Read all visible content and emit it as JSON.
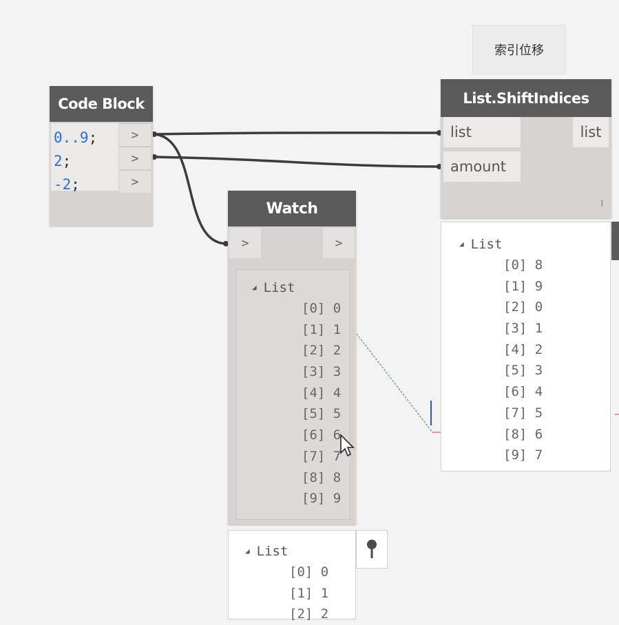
{
  "group_note": "索引位移",
  "code_block": {
    "title": "Code Block",
    "lines": [
      {
        "value": "0..9",
        "semi": ";"
      },
      {
        "value": "2",
        "semi": ";"
      },
      {
        "value": "-2",
        "semi": ";"
      }
    ],
    "port_label": ">"
  },
  "shift_node": {
    "title": "List.ShiftIndices",
    "inputs": [
      "list",
      "amount"
    ],
    "output": "list",
    "lacing": "l"
  },
  "watch_node": {
    "title": "Watch",
    "in_port": ">",
    "out_port": ">",
    "list_label": "List",
    "items": [
      "[0] 0",
      "[1] 1",
      "[2] 2",
      "[3] 3",
      "[4] 4",
      "[5] 5",
      "[6] 6",
      "[7] 7",
      "[8] 8",
      "[9] 9"
    ]
  },
  "shift_preview": {
    "list_label": "List",
    "items": [
      "[0] 8",
      "[1] 9",
      "[2] 0",
      "[3] 1",
      "[4] 2",
      "[5] 3",
      "[6] 4",
      "[7] 5",
      "[8] 6",
      "[9] 7"
    ]
  },
  "watch_preview": {
    "list_label": "List",
    "items": [
      "[0] 0",
      "[1] 1",
      "[2] 2"
    ]
  },
  "colors": {
    "node_header": "#5a5a5a",
    "node_body": "#d6d3d0",
    "wire": "#3c3c3c",
    "code_number": "#2a6dd2",
    "canvas": "#f3f3f3"
  }
}
